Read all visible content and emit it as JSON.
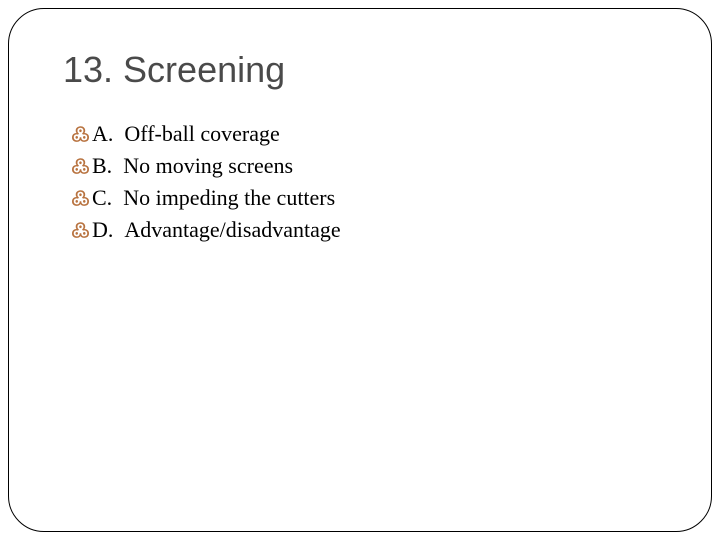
{
  "slide": {
    "title": "13.  Screening",
    "bullets": [
      {
        "label": "A.",
        "text": "Off-ball coverage"
      },
      {
        "label": "B.",
        "text": "No moving screens"
      },
      {
        "label": "C.",
        "text": "No impeding the cutters"
      },
      {
        "label": "D.",
        "text": "Advantage/disadvantage"
      }
    ]
  }
}
